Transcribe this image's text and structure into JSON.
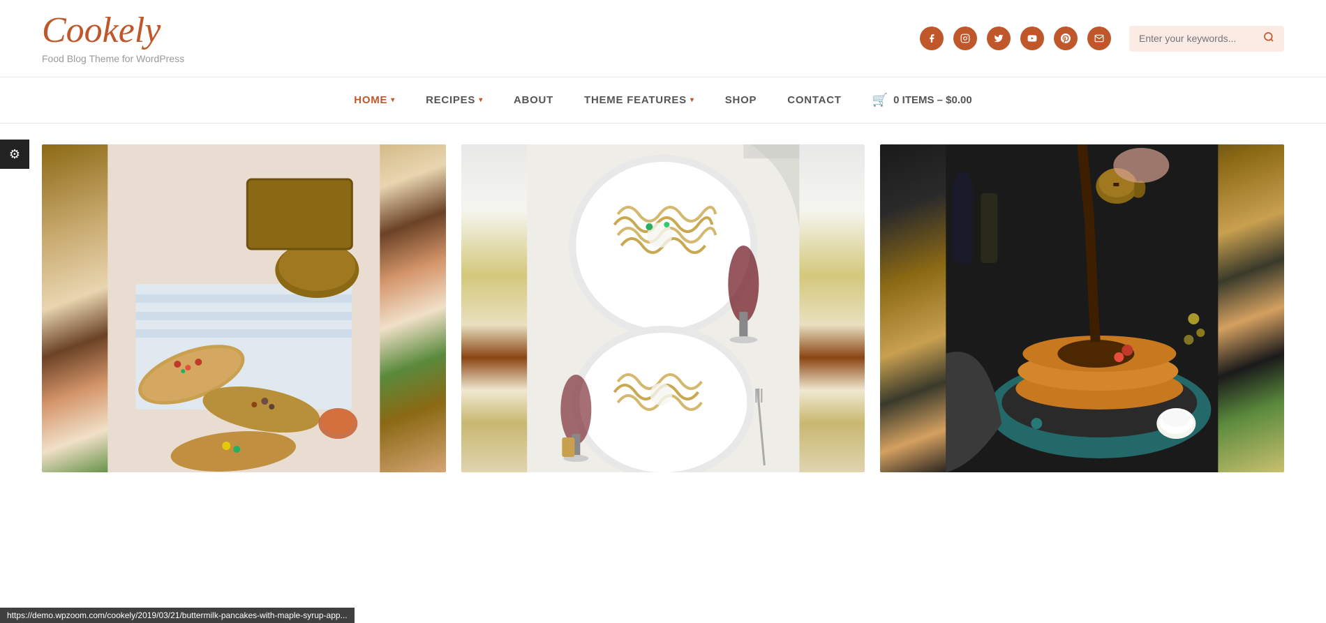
{
  "site": {
    "title": "Cookely",
    "tagline": "Food Blog Theme for WordPress"
  },
  "search": {
    "placeholder": "Enter your keywords..."
  },
  "nav": {
    "items": [
      {
        "label": "HOME",
        "active": true,
        "hasDropdown": true
      },
      {
        "label": "RECIPES",
        "active": false,
        "hasDropdown": true
      },
      {
        "label": "ABOUT",
        "active": false,
        "hasDropdown": false
      },
      {
        "label": "THEME FEATURES",
        "active": false,
        "hasDropdown": true
      },
      {
        "label": "SHOP",
        "active": false,
        "hasDropdown": false
      },
      {
        "label": "CONTACT",
        "active": false,
        "hasDropdown": false
      }
    ],
    "cart": {
      "label": "0 ITEMS – $0.00"
    }
  },
  "social": {
    "icons": [
      "f",
      "i",
      "t",
      "y",
      "p",
      "m"
    ]
  },
  "statusBar": {
    "url": "https://demo.wpzoom.com/cookely/2019/03/21/buttermilk-pancakes-with-maple-syrup-app..."
  },
  "cards": [
    {
      "id": "card-1",
      "type": "bruschetta"
    },
    {
      "id": "card-2",
      "type": "pasta"
    },
    {
      "id": "card-3",
      "type": "pancakes"
    }
  ]
}
